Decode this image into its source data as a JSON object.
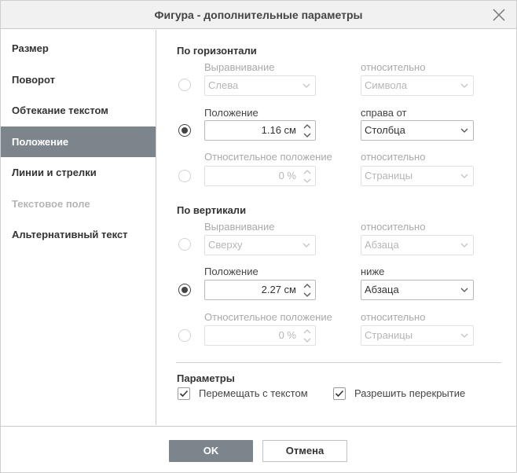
{
  "dialog": {
    "title": "Фигура - дополнительные параметры"
  },
  "sidebar": {
    "items": [
      {
        "label": "Размер"
      },
      {
        "label": "Поворот"
      },
      {
        "label": "Обтекание текстом"
      },
      {
        "label": "Положение",
        "active": true
      },
      {
        "label": "Линии и стрелки"
      },
      {
        "label": "Текстовое поле",
        "disabled": true
      },
      {
        "label": "Альтернативный текст"
      }
    ]
  },
  "horizontal": {
    "title": "По горизонтали",
    "alignment": {
      "label": "Выравнивание",
      "value": "Слева",
      "relative_label": "относительно",
      "relative_value": "Символа"
    },
    "position": {
      "label": "Положение",
      "value": "1.16 см",
      "relative_label": "справа от",
      "relative_value": "Столбца"
    },
    "relative_position": {
      "label": "Относительное положение",
      "value": "0 %",
      "relative_label": "относительно",
      "relative_value": "Страницы"
    }
  },
  "vertical": {
    "title": "По вертикали",
    "alignment": {
      "label": "Выравнивание",
      "value": "Сверху",
      "relative_label": "относительно",
      "relative_value": "Абзаца"
    },
    "position": {
      "label": "Положение",
      "value": "2.27 см",
      "relative_label": "ниже",
      "relative_value": "Абзаца"
    },
    "relative_position": {
      "label": "Относительное положение",
      "value": "0 %",
      "relative_label": "относительно",
      "relative_value": "Страницы"
    }
  },
  "params": {
    "title": "Параметры",
    "move_with_text": {
      "label": "Перемещать с текстом",
      "checked": true
    },
    "allow_overlap": {
      "label": "Разрешить перекрытие",
      "checked": true
    }
  },
  "footer": {
    "ok_label": "OK",
    "cancel_label": "Отмена"
  },
  "colors": {
    "accent": "#7d858c",
    "border": "#cbcbcb"
  }
}
